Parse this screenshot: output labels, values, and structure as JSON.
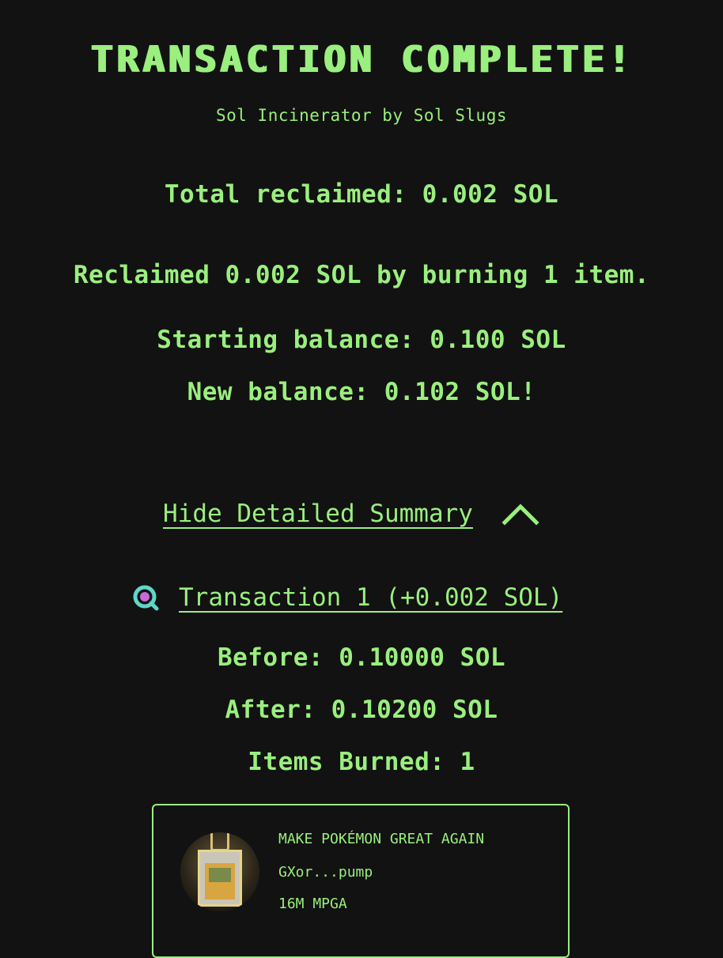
{
  "header": {
    "title": "TRANSACTION COMPLETE!",
    "subtitle": "Sol Incinerator by Sol Slugs"
  },
  "summary": {
    "total_reclaimed": "Total reclaimed: 0.002 SOL",
    "reclaimed_detail": "Reclaimed 0.002 SOL by burning 1 item.",
    "starting_balance": "Starting balance: 0.100 SOL",
    "new_balance": "New balance: 0.102 SOL!"
  },
  "details_toggle": {
    "label": "Hide Detailed Summary",
    "icon": "chevron-up-icon",
    "expanded": true
  },
  "transactions": [
    {
      "link_label": "Transaction 1 (+0.002 SOL)",
      "icon": "explorer-icon",
      "before": "Before: 0.10000 SOL",
      "after": "After: 0.10200 SOL",
      "items_burned": "Items Burned: 1",
      "items": [
        {
          "name": "MAKE POKÉMON GREAT AGAIN",
          "mint": "GXor...pump",
          "amount": "16M MPGA"
        }
      ]
    }
  ],
  "colors": {
    "background": "#121212",
    "accent": "#9aef7e",
    "icon_teal": "#5fd6c8",
    "icon_purple": "#c86ad8"
  }
}
